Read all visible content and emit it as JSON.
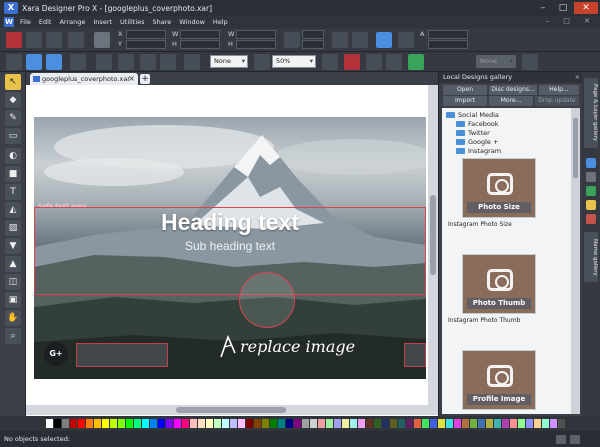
{
  "window": {
    "title": "Xara Designer Pro X - [googleplus_coverphoto.xar]",
    "minimize": "–",
    "maximize": "□",
    "close": "✕"
  },
  "menu": {
    "logo": "W",
    "items": [
      "File",
      "Edit",
      "Arrange",
      "Insert",
      "Utilities",
      "Share",
      "Window",
      "Help"
    ],
    "right": "– □ ✕"
  },
  "toolbar": {
    "field_labels": [
      "X",
      "Y",
      "W",
      "H",
      "W",
      "H"
    ],
    "field_label_a": "A",
    "quality_combo": "None",
    "zoom_combo": "50%",
    "zoom_box": "None"
  },
  "document": {
    "tab_label": "googleplus_coverphoto.xar",
    "tab_close": "×",
    "new_tab": "+"
  },
  "canvas": {
    "safe_area_label": "Safe text area",
    "heading": "Heading text",
    "subheading": "Sub heading text",
    "badge": "G+",
    "replace_image": "replace image"
  },
  "gallery": {
    "title": "Local Designs gallery",
    "close": "×",
    "buttons": {
      "open": "Open",
      "disc_designs": "Disc designs...",
      "help": "Help...",
      "import": "Import",
      "more": "More...",
      "drop_update": "Drop update"
    },
    "tree": {
      "root": "Social Media",
      "children": [
        "Facebook",
        "Twitter",
        "Google +",
        "Instagram"
      ]
    },
    "items": [
      {
        "thumb_label": "Photo Size",
        "caption": "Instagram Photo Size"
      },
      {
        "thumb_label": "Photo Thumb",
        "caption": "Instagram Photo Thumb"
      },
      {
        "thumb_label": "Profile Image",
        "caption": ""
      }
    ]
  },
  "right_tabs": [
    "Page & Layer gallery",
    "Name gallery"
  ],
  "status": {
    "text": "No objects selected:"
  },
  "colors": {
    "accent": "#3b6fd1",
    "safe_area": "#d9434f",
    "chrome": "#353a42"
  }
}
